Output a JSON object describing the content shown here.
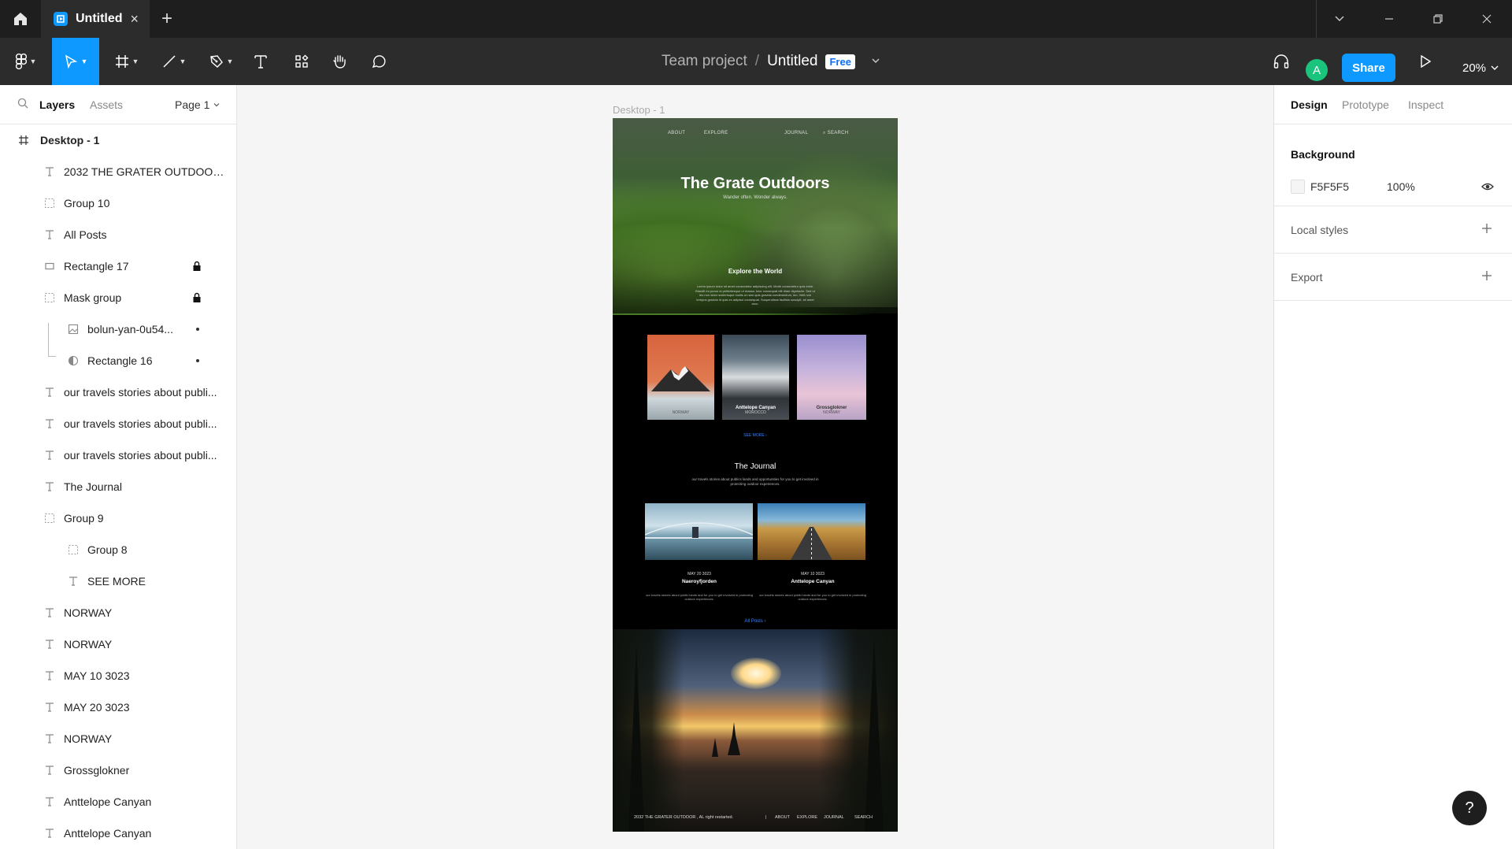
{
  "titlebar": {
    "tab_title": "Untitled",
    "close_glyph": "×",
    "new_tab_glyph": "+"
  },
  "toolbar": {
    "team": "Team project",
    "separator": "/",
    "file_name": "Untitled",
    "plan_badge": "Free",
    "share_label": "Share",
    "avatar_initial": "A",
    "zoom": "20%"
  },
  "left_panel": {
    "tab_layers": "Layers",
    "tab_assets": "Assets",
    "page_label": "Page 1",
    "frame_name": "Desktop - 1",
    "layers": [
      {
        "icon": "text",
        "name": "2032 THE GRATER OUTDOOR..."
      },
      {
        "icon": "group",
        "name": "Group 10"
      },
      {
        "icon": "text",
        "name": "All Posts"
      },
      {
        "icon": "rect",
        "name": "Rectangle 17",
        "locked": true
      },
      {
        "icon": "group",
        "name": "Mask group",
        "locked": true
      },
      {
        "icon": "image",
        "name": "bolun-yan-0u54...",
        "dot": true
      },
      {
        "icon": "mask",
        "name": "Rectangle 16",
        "dot": true
      },
      {
        "icon": "text",
        "name": "our travels stories about publi..."
      },
      {
        "icon": "text",
        "name": "our travels stories about publi..."
      },
      {
        "icon": "text",
        "name": "our travels stories about publi..."
      },
      {
        "icon": "text",
        "name": "The Journal"
      },
      {
        "icon": "group",
        "name": "Group 9"
      },
      {
        "icon": "group",
        "name": "Group 8"
      },
      {
        "icon": "text",
        "name": "SEE MORE"
      },
      {
        "icon": "text",
        "name": "NORWAY"
      },
      {
        "icon": "text",
        "name": "NORWAY"
      },
      {
        "icon": "text",
        "name": "MAY 10 3023"
      },
      {
        "icon": "text",
        "name": "MAY 20 3023"
      },
      {
        "icon": "text",
        "name": "NORWAY"
      },
      {
        "icon": "text",
        "name": "Grossglokner"
      },
      {
        "icon": "text",
        "name": "Anttelope Canyan"
      },
      {
        "icon": "text",
        "name": "Anttelope Canyan"
      }
    ]
  },
  "canvas": {
    "frame_label": "Desktop - 1",
    "nav": {
      "about": "ABOUT",
      "explore": "EXPLORE",
      "journal": "JOURNAL",
      "search": "SEARCH"
    },
    "hero_title": "The Grate Outdoors",
    "hero_subtitle": "Wander often. Wonder always.",
    "explore_heading": "Explore the World",
    "explore_text": "Lorem ipsum dolor sit amet consectetur adipiscing elit. Morbi consectetur quis enim. Blandit eu purus ut pellentesque ut massa, tulor consequat elit diam dignissim. Sed ut leo non dolor scelerisque mollis ut nam quis gravida condimentum, leo. Velit non tempus gravida id quis ex adipisci consequat. Suspendisse facilisis suscipit, sit amet arcu.",
    "cards": [
      {
        "caption": "NORWAY"
      },
      {
        "title": "Anttelope Canyan",
        "caption": "MOROCCO"
      },
      {
        "title": "Grossglokner",
        "caption": "NORWAY"
      }
    ],
    "see_more": "SEE MORE",
    "journal_title": "The Journal",
    "journal_text": "our travels stories about publics lands and opportunities for you to get involved in protecting outdoor experiences.",
    "posts": [
      {
        "date": "MAY 20 3023",
        "name": "Naeroyfjorden",
        "text": "our travels stories about public lands and for you to get involved in protecting outdoor experiences."
      },
      {
        "date": "MAY 10 3023",
        "name": "Anttelope Canyan",
        "text": "our travels stories about public lands and for you to get involved in protecting outdoor experiences."
      }
    ],
    "all_posts": "All Posts",
    "footer_copy": "2032 THE GRATER OUTDOOR , AL right restarted.",
    "footer_sep": "|",
    "footer_links": [
      "ABOUT",
      "EXPLORE",
      "JOURNAL",
      "SEARCH"
    ]
  },
  "right_panel": {
    "tab_design": "Design",
    "tab_prototype": "Prototype",
    "tab_inspect": "Inspect",
    "background_label": "Background",
    "background_hex": "F5F5F5",
    "background_opacity": "100%",
    "local_styles": "Local styles",
    "export": "Export"
  },
  "help_glyph": "?",
  "colors": {
    "accent": "#0d99ff",
    "titlebar": "#1e1e1e",
    "toolbar": "#2c2c2c",
    "canvas_bg": "#F5F5F5",
    "avatar": "#1bc47d"
  }
}
